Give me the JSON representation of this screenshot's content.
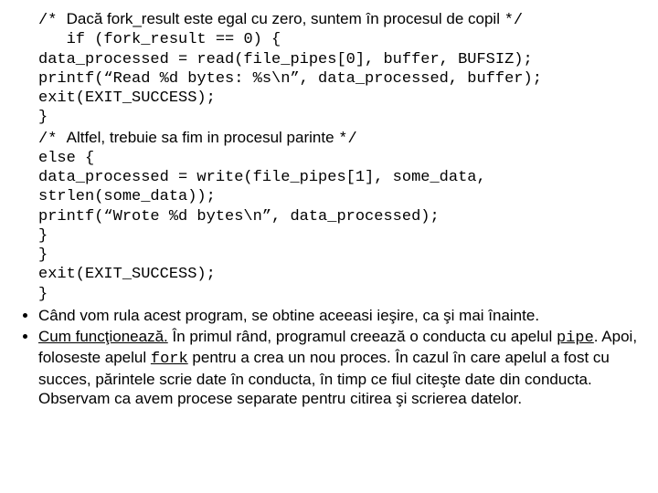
{
  "comment1_prefix": "/* ",
  "comment1_text": "Dacă fork_result este egal cu zero, suntem în procesul de copil ",
  "comment1_suffix": "*/",
  "code1_line1": "   if (fork_result == 0) {",
  "code1_line2": "data_processed = read(file_pipes[0], buffer, BUFSIZ);",
  "code1_line3": "printf(“Read %d bytes: %s\\n”, data_processed, buffer);",
  "code1_line4": "exit(EXIT_SUCCESS);",
  "code1_line5": "}",
  "comment2_prefix": "/* ",
  "comment2_text": "Altfel, trebuie sa fim in procesul parinte ",
  "comment2_suffix": "*/",
  "code2_line1": "else {",
  "code2_line2": "data_processed = write(file_pipes[1], some_data,",
  "code2_line3": "strlen(some_data));",
  "code2_line4": "printf(“Wrote %d bytes\\n”, data_processed);",
  "code2_line5": "}",
  "code2_line6": "}",
  "code2_line7": "exit(EXIT_SUCCESS);",
  "code2_line8": "}",
  "bullet1": "Când vom rula acest program, se obtine aceeasi ieşire, ca şi mai înainte.",
  "bullet2a": "Cum funcţionează.",
  "bullet2b": " În primul rând, programul creează o conducta cu apelul ",
  "bullet2c": "pipe",
  "bullet2d": ". Apoi, foloseste apelul ",
  "bullet2e": "fork",
  "bullet2f": " pentru a crea un nou proces. În cazul în care apelul a fost cu succes, părintele scrie date în conducta, în timp ce fiul citeşte date din conducta. Observam ca avem procese separate pentru citirea şi scrierea datelor."
}
